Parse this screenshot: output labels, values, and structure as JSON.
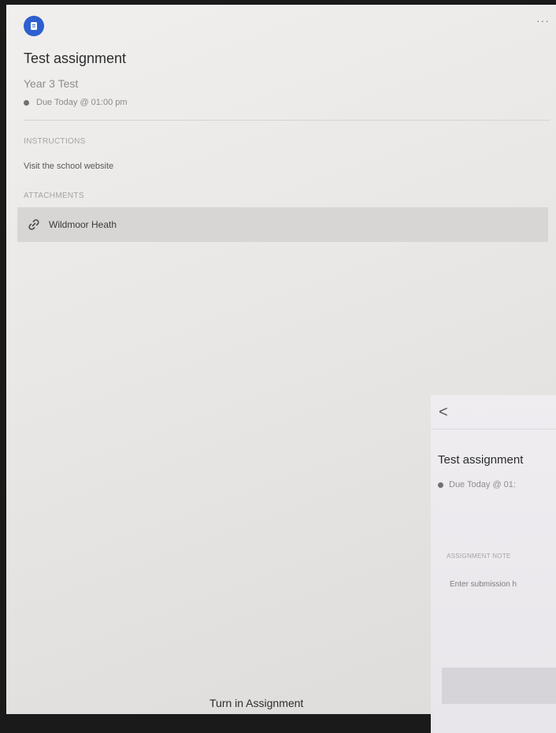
{
  "assignment": {
    "title": "Test assignment",
    "class_name": "Year 3 Test",
    "due": "Due Today @ 01:00 pm"
  },
  "header": {
    "more_label": "···"
  },
  "instructions": {
    "label": "INSTRUCTIONS",
    "text": "Visit the school website"
  },
  "attachments": {
    "label": "ATTACHMENTS",
    "items": [
      {
        "label": "Wildmoor Heath",
        "icon": "link-icon"
      }
    ]
  },
  "footer": {
    "turn_in_label": "Turn in Assignment"
  },
  "submission_view": {
    "back_label": "<",
    "title": "Test assignment",
    "due": "Due Today @ 01:",
    "note_label": "ASSIGNMENT NOTE",
    "note_placeholder": "Enter submission h"
  },
  "colors": {
    "accent": "#2d5fd1",
    "background": "#ebe9e7",
    "attachment_bg": "#d8d6d4"
  }
}
